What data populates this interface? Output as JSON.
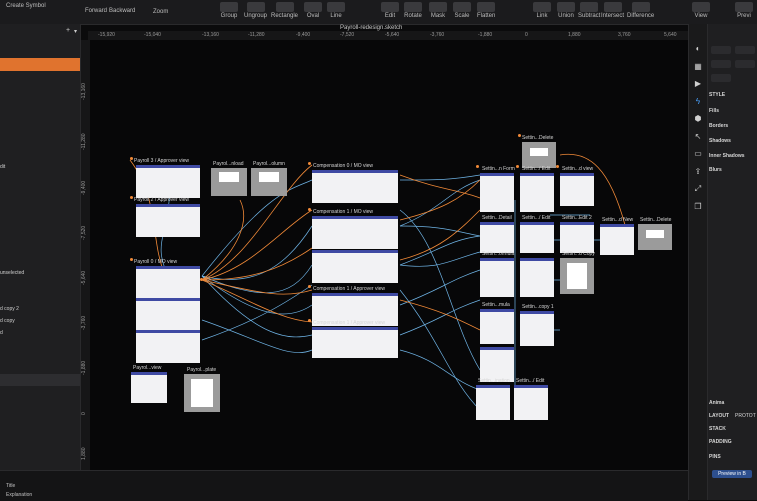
{
  "toolbar": {
    "create_symbol": "Create Symbol",
    "forward": "Forward",
    "backward": "Backward",
    "zoom": "Zoom",
    "group": "Group",
    "ungroup": "Ungroup",
    "rectangle": "Rectangle",
    "oval": "Oval",
    "line": "Line",
    "edit": "Edit",
    "rotate": "Rotate",
    "mask": "Mask",
    "scale": "Scale",
    "flatten": "Flatten",
    "link": "Link",
    "union": "Union",
    "subtract": "Subtract",
    "intersect": "Intersect",
    "difference": "Difference",
    "view": "View",
    "preview": "Previ"
  },
  "document_title": "Payroll-redesign.sketch",
  "rulers": {
    "top": [
      "-15,920",
      "-15,040",
      "-13,160",
      "-11,280",
      "-9,400",
      "-7,520",
      "-5,640",
      "-3,760",
      "-1,880",
      "0",
      "1,880",
      "3,760",
      "5,640"
    ],
    "left": [
      "-13,160",
      "-11,280",
      "-9,400",
      "-7,520",
      "-5,640",
      "-3,760",
      "-1,880",
      "0",
      "1,880"
    ]
  },
  "sidebar": {
    "items": [
      "dit",
      "unselected",
      "d copy 2",
      "d copy",
      "d"
    ]
  },
  "artboards": [
    {
      "label": "Payroll 3 / Approver view"
    },
    {
      "label": "Payroll 2 / Approver view"
    },
    {
      "label": "Payroll 0 / MO view"
    },
    {
      "label": "Payrol...view"
    },
    {
      "label": "Payrol...plate"
    },
    {
      "label": "Payrol...nload"
    },
    {
      "label": "Payrol...olumn"
    },
    {
      "label": "Compensation 0 / MO view"
    },
    {
      "label": "Compensation 1 / MO view"
    },
    {
      "label": "Compensation 1 / Approver view"
    },
    {
      "label": "Compensation 1 / Approver view"
    },
    {
      "label": "Settin...Delete"
    },
    {
      "label": "Settin...n Form"
    },
    {
      "label": "Settin.../ Edit"
    },
    {
      "label": "Settin...d view"
    },
    {
      "label": "Settin...Detail"
    },
    {
      "label": "Settin.../ Edit"
    },
    {
      "label": "Settin...Edit 2"
    },
    {
      "label": "Settin...d New"
    },
    {
      "label": "Settin...Delete"
    },
    {
      "label": "Settin...ormula"
    },
    {
      "label": "Settin...d Copy"
    },
    {
      "label": "Settin...mula"
    },
    {
      "label": "Settin...copy 1"
    },
    {
      "label": "Settin...ination"
    },
    {
      "label": "Settin.../ Edit"
    }
  ],
  "inspector": {
    "style": "STYLE",
    "fills": "Fills",
    "borders": "Borders",
    "shadows": "Shadows",
    "inner_shadows": "Inner Shadows",
    "blurs": "Blurs",
    "anima": "Anima",
    "layout": "LAYOUT",
    "proto": "PROTOT",
    "stack": "STACK",
    "padding": "PADDING",
    "pins": "PINS",
    "preview_btn": "Preview in B"
  },
  "bottom": {
    "title": "Title",
    "explanation": "Explanation"
  },
  "colors": {
    "accent": "#e0732e",
    "connector_blue": "#6fb4e6",
    "connector_orange": "#f28a38",
    "header_blue": "#3f4aa3"
  }
}
